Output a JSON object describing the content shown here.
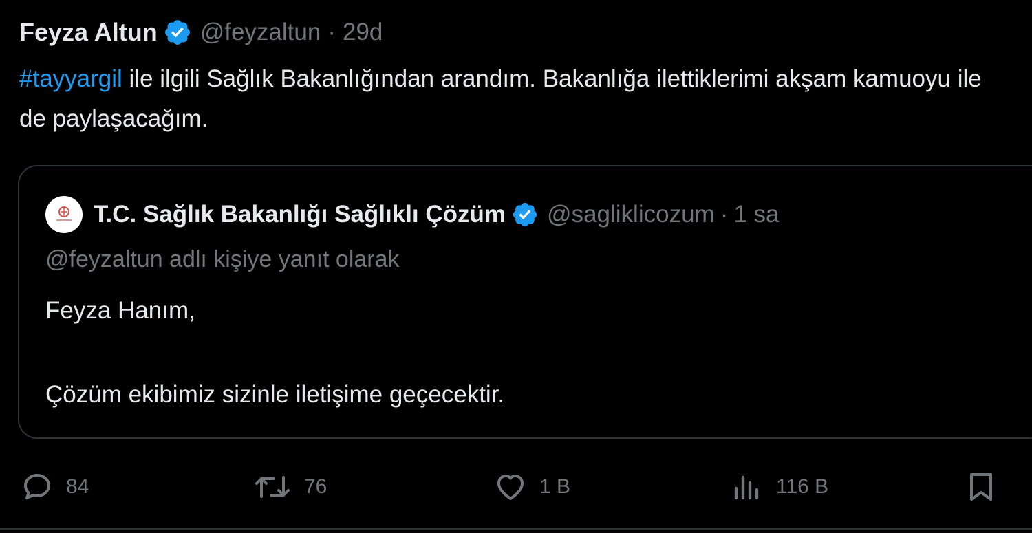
{
  "tweet": {
    "author_name": "Feyza Altun",
    "handle": "@feyzaltun",
    "separator": "·",
    "time": "29d",
    "hashtag": "#tayyargil",
    "text_after_hashtag": " ile ilgili Sağlık Bakanlığından arandım. Bakanlığa ilettiklerimi akşam kamuoyu ile de paylaşacağım."
  },
  "quote": {
    "author_name": "T.C. Sağlık Bakanlığı Sağlıklı Çözüm",
    "handle": "@sagliklicozum",
    "separator": "·",
    "time": "1 sa",
    "reply_to": "@feyzaltun adlı kişiye yanıt olarak",
    "line1": "Feyza Hanım,",
    "line2": "Çözüm ekibimiz sizinle iletişime geçecektir."
  },
  "actions": {
    "reply": {
      "icon": "reply-icon",
      "count": "84"
    },
    "retweet": {
      "icon": "retweet-icon",
      "count": "76"
    },
    "like": {
      "icon": "heart-icon",
      "count": "1 B"
    },
    "views": {
      "icon": "views-icon",
      "count": "116 B"
    },
    "bookmark": {
      "icon": "bookmark-icon"
    }
  },
  "colors": {
    "background": "#000000",
    "text": "#e7e9ea",
    "muted": "#71767b",
    "accent": "#1d9bf0",
    "border": "#2f3336"
  }
}
